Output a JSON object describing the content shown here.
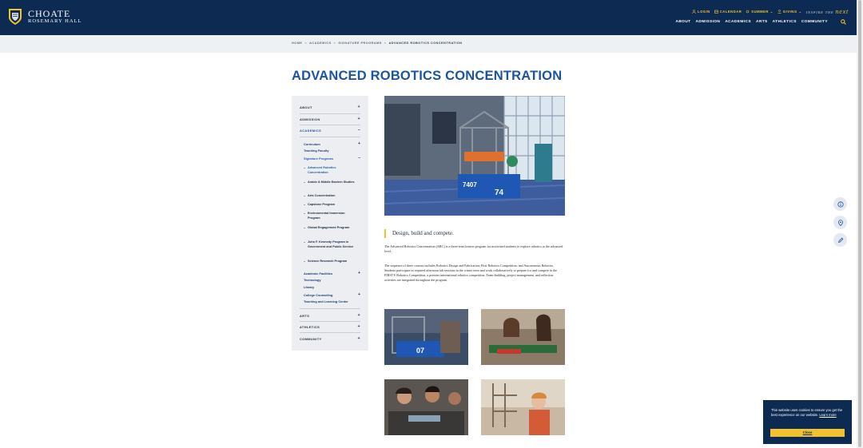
{
  "brand": {
    "line1": "CHOATE",
    "line2": "ROSEMARY HALL"
  },
  "utility": {
    "login": "LOGIN",
    "calendar": "CALENDAR",
    "summer": "SUMMER",
    "giving": "GIVING",
    "inspire": "INSPIRE THE",
    "inspire_next": "next"
  },
  "nav": {
    "about": "ABOUT",
    "admission": "ADMISSION",
    "academics": "ACADEMICS",
    "arts": "ARTS",
    "athletics": "ATHLETICS",
    "community": "COMMUNITY"
  },
  "breadcrumb": {
    "home": "HOME",
    "academics": "ACADEMICS",
    "signature": "SIGNATURE PROGRAMS",
    "current": "ADVANCED ROBOTICS CONCENTRATION",
    "sep": ">"
  },
  "page": {
    "title": "ADVANCED ROBOTICS CONCENTRATION"
  },
  "sidebar": {
    "about": "ABOUT",
    "admission": "ADMISSION",
    "academics": "ACADEMICS",
    "curriculum": "Curriculum",
    "teaching_faculty": "Teaching Faculty",
    "signature_programs": "Signature Programs",
    "programs": [
      "Advanced Robotics Concentration",
      "Arabic & Middle Eastern Studies",
      "Arts Concentration",
      "Capstone Program",
      "Environmental Immersion Program",
      "Global Engagement Program",
      "John F. Kennedy Program in Government and Public Service",
      "Science Research Program"
    ],
    "academic_facilities": "Academic Facilities",
    "technology": "Technology",
    "library": "Library",
    "college_counseling": "College Counseling",
    "teaching_learning": "Teaching and Learning Center",
    "arts": "ARTS",
    "athletics": "ATHLETICS",
    "community": "COMMUNITY",
    "plus": "+",
    "minus": "–"
  },
  "content": {
    "tagline": "Design, build and compete.",
    "para1": "The Advanced Robotics Concentration (ARC) is a three-term honors program for motivated students to explore robotics at the advanced level.",
    "para2": "The sequence of three courses includes Robotics Design and Fabrication; First Robotics Competition; and Autonomous Robotics. Students participate in required afternoon lab sessions in the winter term and work collaboratively to prepare for and compete in the FIRST® Robotics Competition, a premier international robotics competition. Team-building, project management, and reflection activities are integrated throughout the program.",
    "robot_number": "7407",
    "robot_number2": "74",
    "thumb_number": "07"
  },
  "cookie": {
    "text": "This website uses cookies to ensure you get the best experience on our website.",
    "learn_more": "Learn more",
    "close": "Close"
  },
  "colors": {
    "navy": "#0d2a52",
    "gold": "#f2c12e",
    "title_blue": "#1b54a3",
    "robot_blue": "#1f57b5"
  }
}
